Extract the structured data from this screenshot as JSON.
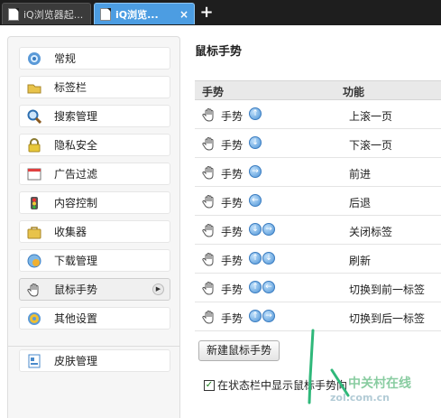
{
  "tabs": [
    {
      "title": "iQ浏览器起...",
      "active": false
    },
    {
      "title": "iQ浏览...",
      "active": true
    }
  ],
  "new_tab_label": "+",
  "close_glyph": "×",
  "sidebar": {
    "items": [
      {
        "label": "常规",
        "icon": "gear-blue-icon"
      },
      {
        "label": "标签栏",
        "icon": "tab-folder-icon"
      },
      {
        "label": "搜索管理",
        "icon": "magnifier-icon"
      },
      {
        "label": "隐私安全",
        "icon": "lock-icon"
      },
      {
        "label": "广告过滤",
        "icon": "window-filter-icon"
      },
      {
        "label": "内容控制",
        "icon": "traffic-light-icon"
      },
      {
        "label": "收集器",
        "icon": "briefcase-icon"
      },
      {
        "label": "下载管理",
        "icon": "download-icon"
      },
      {
        "label": "鼠标手势",
        "icon": "hand-icon",
        "selected": true
      },
      {
        "label": "其他设置",
        "icon": "gears-icon"
      }
    ],
    "bottom_items": [
      {
        "label": "皮肤管理",
        "icon": "skin-icon"
      }
    ]
  },
  "main": {
    "title": "鼠标手势",
    "columns": {
      "gesture": "手势",
      "function": "功能"
    },
    "rows": [
      {
        "gesture": "手势",
        "arrows": [
          "↑"
        ],
        "function": "上滚一页"
      },
      {
        "gesture": "手势",
        "arrows": [
          "↓"
        ],
        "function": "下滚一页"
      },
      {
        "gesture": "手势",
        "arrows": [
          "→"
        ],
        "function": "前进"
      },
      {
        "gesture": "手势",
        "arrows": [
          "←"
        ],
        "function": "后退"
      },
      {
        "gesture": "手势",
        "arrows": [
          "↓",
          "→"
        ],
        "function": "关闭标签"
      },
      {
        "gesture": "手势",
        "arrows": [
          "↑",
          "↓"
        ],
        "function": "刷新"
      },
      {
        "gesture": "手势",
        "arrows": [
          "↑",
          "←"
        ],
        "function": "切换到前一标签"
      },
      {
        "gesture": "手势",
        "arrows": [
          "↑",
          "→"
        ],
        "function": "切换到后一标签"
      }
    ],
    "new_gesture_button": "新建鼠标手势",
    "statusbar_checkbox": {
      "label": "在状态栏中显示鼠标手势向",
      "checked": true
    }
  },
  "watermark": {
    "cn": "中关村在线",
    "en": "zol.com.cn"
  },
  "colors": {
    "accent": "#4c9de2",
    "tabbar": "#1e1e1e",
    "stroke": "#2fb87a"
  }
}
